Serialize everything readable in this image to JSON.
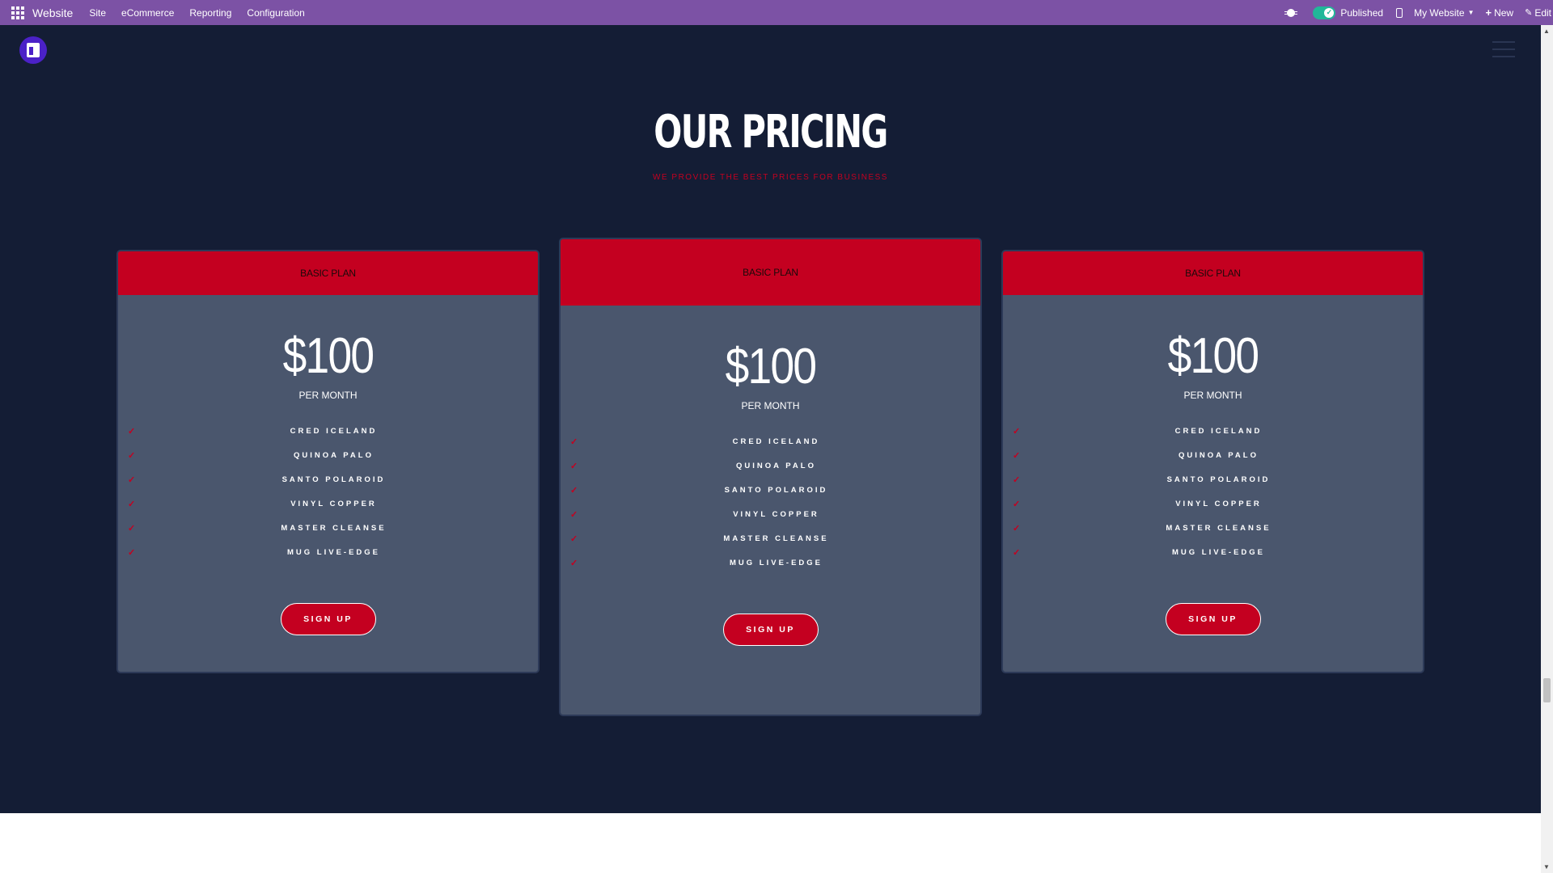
{
  "topbar": {
    "app_name": "Website",
    "menu": [
      "Site",
      "eCommerce",
      "Reporting",
      "Configuration"
    ],
    "published_label": "Published",
    "website_selector": "My Website",
    "new_label": "New",
    "edit_label": "Edit"
  },
  "page": {
    "heading": "OUR PRICING",
    "subheading": "WE PROVIDE THE BEST PRICES FOR BUSINESS"
  },
  "plans": [
    {
      "name": "BASIC PLAN",
      "price": "$100",
      "period": "PER MONTH",
      "features": [
        "CRED ICELAND",
        "QUINOA PALO",
        "SANTO POLAROID",
        "VINYL COPPER",
        "MASTER CLEANSE",
        "MUG LIVE-EDGE"
      ],
      "cta": "SIGN UP"
    },
    {
      "name": "BASIC PLAN",
      "price": "$100",
      "period": "PER MONTH",
      "features": [
        "CRED ICELAND",
        "QUINOA PALO",
        "SANTO POLAROID",
        "VINYL COPPER",
        "MASTER CLEANSE",
        "MUG LIVE-EDGE"
      ],
      "cta": "SIGN UP"
    },
    {
      "name": "BASIC PLAN",
      "price": "$100",
      "period": "PER MONTH",
      "features": [
        "CRED ICELAND",
        "QUINOA PALO",
        "SANTO POLAROID",
        "VINYL COPPER",
        "MASTER CLEANSE",
        "MUG LIVE-EDGE"
      ],
      "cta": "SIGN UP"
    }
  ],
  "colors": {
    "admin_bar": "#7c52a5",
    "site_background": "#141d35",
    "card_background": "#4a566d",
    "accent": "#c40020",
    "toggle_on": "#21b799"
  },
  "icons": [
    "apps-grid-icon",
    "bug-icon",
    "check-icon",
    "mobile-icon",
    "plus-icon",
    "pencil-icon",
    "logo-icon",
    "hamburger-menu-icon"
  ]
}
